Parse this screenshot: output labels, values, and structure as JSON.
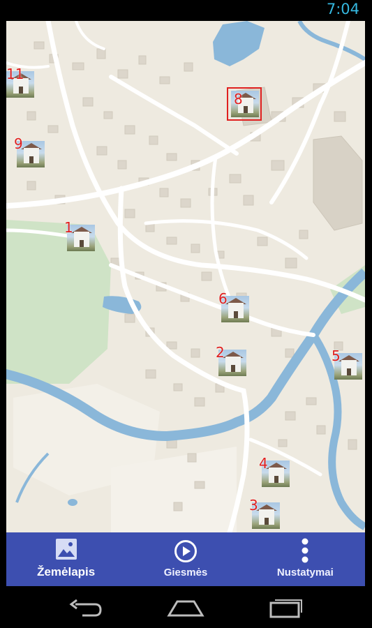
{
  "status_bar": {
    "time": "7:04"
  },
  "map": {
    "markers": [
      {
        "number": "1"
      },
      {
        "number": "2"
      },
      {
        "number": "3"
      },
      {
        "number": "4"
      },
      {
        "number": "5"
      },
      {
        "number": "6"
      },
      {
        "number": "8",
        "selected": true
      },
      {
        "number": "9"
      },
      {
        "number": "11"
      }
    ],
    "colors": {
      "land": "#eeeae0",
      "road": "#ffffff",
      "water": "#8ab7d9",
      "park": "#cfe3c6",
      "building": "#ddd8ce",
      "marker_number": "#e0201f"
    }
  },
  "bottom_nav": {
    "background": "#3d4fb0",
    "items": [
      {
        "label": "Žemėlapis",
        "icon": "image-icon",
        "active": true
      },
      {
        "label": "Giesmės",
        "icon": "play-circle-icon"
      },
      {
        "label": "Nustatymai",
        "icon": "more-vert-icon"
      }
    ]
  },
  "system_nav": {
    "icons": [
      "back-icon",
      "home-icon",
      "recent-apps-icon"
    ]
  }
}
